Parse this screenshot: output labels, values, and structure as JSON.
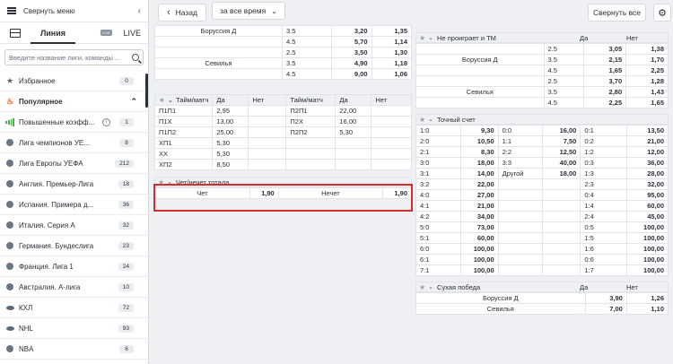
{
  "sidebar": {
    "collapse_label": "Свернуть меню",
    "tab_line": "Линия",
    "tab_live": "LIVE",
    "live_badge": "LIVE",
    "search_placeholder": "Введите название лиги, команды ...",
    "items": [
      {
        "label": "Избранное",
        "count": "0"
      },
      {
        "label": "Популярное"
      },
      {
        "label": "Повышенные коэфф...",
        "count": "1"
      },
      {
        "label": "Лига чемпионов УЕ...",
        "count": "8"
      },
      {
        "label": "Лига Европы УЕФА",
        "count": "212"
      },
      {
        "label": "Англия. Премьер-Лига",
        "count": "18"
      },
      {
        "label": "Испания. Примера д...",
        "count": "36"
      },
      {
        "label": "Италия. Серия А",
        "count": "32"
      },
      {
        "label": "Германия. Бундеслига",
        "count": "23"
      },
      {
        "label": "Франция. Лига 1",
        "count": "24"
      },
      {
        "label": "Австралия. А-лига",
        "count": "10"
      },
      {
        "label": "КХЛ",
        "count": "72"
      },
      {
        "label": "NHL",
        "count": "93"
      },
      {
        "label": "NBA",
        "count": "6"
      }
    ]
  },
  "topbar": {
    "back": "Назад",
    "period": "за все время",
    "collapse_all": "Свернуть все"
  },
  "left_col": {
    "top_rows": [
      {
        "name": "Боруссия Д",
        "v": "3.5",
        "a": "3,20",
        "b": "1,35"
      },
      {
        "name": "",
        "v": "4.5",
        "a": "5,70",
        "b": "1,14"
      },
      {
        "name": "",
        "v": "2.5",
        "a": "3,50",
        "b": "1,30"
      },
      {
        "name": "Севилья",
        "v": "3.5",
        "a": "4,90",
        "b": "1,18"
      },
      {
        "name": "",
        "v": "4.5",
        "a": "9,00",
        "b": "1,06"
      }
    ],
    "half": {
      "title": "Тайм/матч",
      "cols": [
        "Да",
        "Нет",
        "Тайм/матч",
        "Да",
        "Нет"
      ],
      "rows": [
        [
          "П1П1",
          "2,95",
          "",
          "П2П1",
          "22,00"
        ],
        [
          "П1Х",
          "13,00",
          "",
          "П2Х",
          "16,00"
        ],
        [
          "П1П2",
          "25,00",
          "",
          "П2П2",
          "5,30"
        ],
        [
          "ХП1",
          "5,30",
          "",
          "",
          ""
        ],
        [
          "ХХ",
          "5,30",
          "",
          "",
          ""
        ],
        [
          "ХП2",
          "8,50",
          "",
          "",
          ""
        ]
      ]
    },
    "oddeven": {
      "title": "Чет/нечет тотала",
      "even": "Чет",
      "even_v": "1,90",
      "odd": "Нечет",
      "odd_v": "1,90"
    }
  },
  "right_col": {
    "nolose": {
      "title": "Не проиграет и ТМ",
      "yes": "Да",
      "no": "Нет",
      "rows": [
        {
          "name": "",
          "v": "2.5",
          "a": "3,05",
          "b": "1,38"
        },
        {
          "name": "Боруссия Д",
          "v": "3.5",
          "a": "2,15",
          "b": "1,70"
        },
        {
          "name": "",
          "v": "4.5",
          "a": "1,65",
          "b": "2,25"
        },
        {
          "name": "",
          "v": "2.5",
          "a": "3,70",
          "b": "1,28"
        },
        {
          "name": "Севилья",
          "v": "3.5",
          "a": "2,80",
          "b": "1,43"
        },
        {
          "name": "",
          "v": "4.5",
          "a": "2,25",
          "b": "1,65"
        }
      ]
    },
    "exact": {
      "title": "Точный счет",
      "rows": [
        [
          "1:0",
          "9,30",
          "0:0",
          "16,00",
          "0:1",
          "13,50"
        ],
        [
          "2:0",
          "10,50",
          "1:1",
          "7,50",
          "0:2",
          "21,00"
        ],
        [
          "2:1",
          "8,30",
          "2:2",
          "12,50",
          "1:2",
          "12,00"
        ],
        [
          "3:0",
          "18,00",
          "3:3",
          "40,00",
          "0:3",
          "36,00"
        ],
        [
          "3:1",
          "14,00",
          "Другой",
          "18,00",
          "1:3",
          "28,00"
        ],
        [
          "3:2",
          "22,00",
          "",
          "",
          "2:3",
          "32,00"
        ],
        [
          "4:0",
          "27,00",
          "",
          "",
          "0:4",
          "95,00"
        ],
        [
          "4:1",
          "21,00",
          "",
          "",
          "1:4",
          "60,00"
        ],
        [
          "4:2",
          "34,00",
          "",
          "",
          "2:4",
          "45,00"
        ],
        [
          "5:0",
          "73,00",
          "",
          "",
          "0:5",
          "100,00"
        ],
        [
          "5:1",
          "60,00",
          "",
          "",
          "1:5",
          "100,00"
        ],
        [
          "6:0",
          "100,00",
          "",
          "",
          "1:6",
          "100,00"
        ],
        [
          "6:1",
          "100,00",
          "",
          "",
          "0:6",
          "100,00"
        ],
        [
          "7:1",
          "100,00",
          "",
          "",
          "1:7",
          "100,00"
        ]
      ]
    },
    "clean": {
      "title": "Сухая победа",
      "yes": "Да",
      "no": "Нет",
      "rows": [
        {
          "name": "Боруссия Д",
          "a": "3,90",
          "b": "1,26"
        },
        {
          "name": "Севилья",
          "a": "7,00",
          "b": "1,10"
        }
      ]
    }
  }
}
